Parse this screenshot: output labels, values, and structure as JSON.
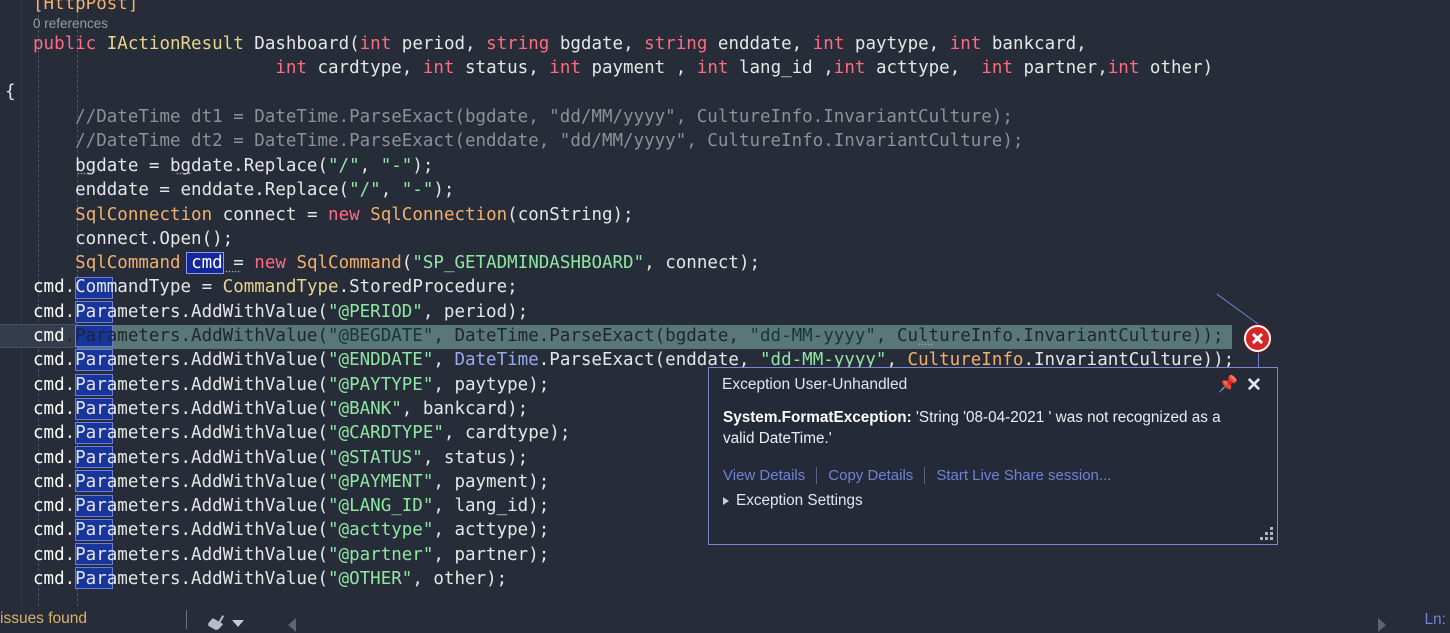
{
  "editor": {
    "attribute_line": "[HttpPost]",
    "codelens": "0 references",
    "lines": [
      {
        "id": "signature1",
        "text": "public IActionResult Dashboard(int period, string bgdate, string enddate, int paytype, int bankcard,"
      },
      {
        "id": "signature2",
        "text": "int cardtype, int status, int payment , int lang_id ,int acttype,  int partner,int other)"
      },
      {
        "id": "open-brace",
        "text": "{"
      },
      {
        "id": "comment1",
        "text": "//DateTime dt1 = DateTime.ParseExact(bgdate, \"dd/MM/yyyy\", CultureInfo.InvariantCulture);"
      },
      {
        "id": "comment2",
        "text": "//DateTime dt2 = DateTime.ParseExact(enddate, \"dd/MM/yyyy\", CultureInfo.InvariantCulture);"
      },
      {
        "id": "bgdate-replace",
        "text": "bgdate = bgdate.Replace(\"/\", \"-\");"
      },
      {
        "id": "enddate-replace",
        "text": "enddate = enddate.Replace(\"/\", \"-\");"
      },
      {
        "id": "sqlconnection",
        "text": "SqlConnection connect = new SqlConnection(conString);"
      },
      {
        "id": "connect-open",
        "text": "connect.Open();"
      },
      {
        "id": "sqlcommand",
        "text": "SqlCommand cmd = new SqlCommand(\"SP_GETADMINDASHBOARD\", connect);"
      },
      {
        "id": "commandtype",
        "text": "cmd.CommandType = CommandType.StoredProcedure;"
      },
      {
        "id": "param-period",
        "text": "cmd.Parameters.AddWithValue(\"@PERIOD\", period);"
      },
      {
        "id": "param-begdate",
        "text": "cmd.Parameters.AddWithValue(\"@BEGDATE\", DateTime.ParseExact(bgdate, \"dd-MM-yyyy\", CultureInfo.InvariantCulture));"
      },
      {
        "id": "param-enddate",
        "text": "cmd.Parameters.AddWithValue(\"@ENDDATE\", DateTime.ParseExact(enddate, \"dd-MM-yyyy\", CultureInfo.InvariantCulture));"
      },
      {
        "id": "param-paytype",
        "text": "cmd.Parameters.AddWithValue(\"@PAYTYPE\", paytype);"
      },
      {
        "id": "param-bank",
        "text": "cmd.Parameters.AddWithValue(\"@BANK\", bankcard);"
      },
      {
        "id": "param-cardtype",
        "text": "cmd.Parameters.AddWithValue(\"@CARDTYPE\", cardtype);"
      },
      {
        "id": "param-status",
        "text": "cmd.Parameters.AddWithValue(\"@STATUS\", status);"
      },
      {
        "id": "param-payment",
        "text": "cmd.Parameters.AddWithValue(\"@PAYMENT\", payment);"
      },
      {
        "id": "param-langid",
        "text": "cmd.Parameters.AddWithValue(\"@LANG_ID\", lang_id);"
      },
      {
        "id": "param-acttype",
        "text": "cmd.Parameters.AddWithValue(\"@acttype\", acttype);"
      },
      {
        "id": "param-partner",
        "text": "cmd.Parameters.AddWithValue(\"@partner\", partner);"
      },
      {
        "id": "param-other",
        "text": "cmd.Parameters.AddWithValue(\"@OTHER\", other);"
      }
    ]
  },
  "exception_popup": {
    "title": "Exception User-Unhandled",
    "exception_type": "System.FormatException:",
    "message": "'String '08-04-2021 ' was not recognized as a valid DateTime.'",
    "links": [
      {
        "id": "view-details",
        "label": "View Details"
      },
      {
        "id": "copy-details",
        "label": "Copy Details"
      },
      {
        "id": "start-live-share",
        "label": "Start Live Share session..."
      }
    ],
    "settings_label": "Exception Settings",
    "pin_icon": "pin-icon",
    "close_icon": "close-icon",
    "error_icon": "error-circle-icon",
    "resize_icon": "resize-grip-icon"
  },
  "statusbar": {
    "issues_text": "issues found",
    "broom_icon": "broom-icon",
    "dropdown_icon": "chevron-down-icon",
    "prev_icon": "chevron-left-icon",
    "next_icon": "chevron-right-icon",
    "line_label": "Ln:"
  },
  "colors": {
    "editor_background": "#262C38",
    "popup_background": "#252A38",
    "popup_border": "#7b88cf",
    "error_red": "#d62626",
    "link_blue": "#6f82d6",
    "exec_highlight": "#6f9490",
    "reference_highlight": "#18359c",
    "keyword": "#ff6b81",
    "string": "#8fe6a4",
    "comment": "#8d9097",
    "type": "#e8d48a",
    "issues_amber": "#d8b26a"
  }
}
